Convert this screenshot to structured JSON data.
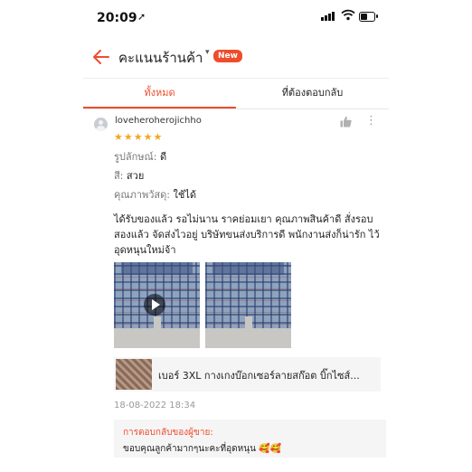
{
  "status_bar": {
    "time": "20:09",
    "location_icon": "➚"
  },
  "header": {
    "title": "คะแนนร้านค้า",
    "badge": "New"
  },
  "tabs": [
    {
      "label": "ทั้งหมด",
      "active": true
    },
    {
      "label": "ที่ต้องตอบกลับ",
      "active": false
    }
  ],
  "review": {
    "username": "loveheroherojichho",
    "stars": "★★★★★",
    "rating": 5,
    "attributes": [
      {
        "key": "รูปลักษณ์:",
        "value": "ดี"
      },
      {
        "key": "สี:",
        "value": "สวย"
      },
      {
        "key": "คุณภาพวัสดุ:",
        "value": "ใช้ได้"
      }
    ],
    "comment": "ได้รับของแล้ว รอไม่นาน ราคย่อมเยา คุณภาพสินค้าดี สั่งรอบสองแล้ว จัดส่งไวอยู่ บริษัทขนส่งบริการดี พนักงานส่งก็น่ารัก ไว้อุดหนุนใหม่จ้า",
    "product_name": "เบอร์ 3XL กางเกงบ๊อกเซอร์ลายสก๊อต บิ๊กไซส์...",
    "date": "18-08-2022 18:34",
    "seller_reply_label": "การตอบกลับของผู้ขาย:",
    "seller_reply_text": "ขอบคุณลูกค้ามากๆนะคะที่อุดหนุน 🥰🥰"
  },
  "colors": {
    "accent": "#ee4d2d",
    "star": "#f5a623",
    "muted": "#999999"
  }
}
